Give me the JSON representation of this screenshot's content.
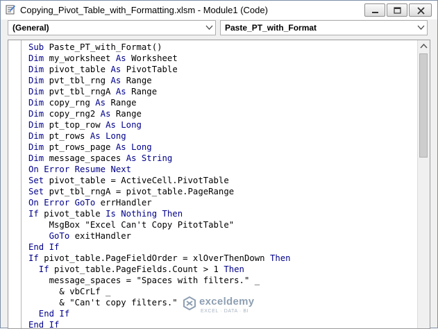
{
  "window": {
    "title": "Copying_Pivot_Table_with_Formatting.xlsm - Module1 (Code)",
    "icons": {
      "app": "vba-module-icon",
      "minimize": "minimize-icon",
      "maximize": "maximize-icon",
      "close": "close-icon"
    }
  },
  "object_combo": {
    "value": "(General)"
  },
  "procedure_combo": {
    "value": "Paste_PT_with_Format"
  },
  "colors": {
    "keyword": "#00008b",
    "plain": "#000000",
    "watermark": "#7b8fa6"
  },
  "code_lines": [
    [
      {
        "t": "Sub ",
        "k": "kw"
      },
      {
        "t": "Paste_PT_with_Format()",
        "k": "pl"
      }
    ],
    [
      {
        "t": "Dim ",
        "k": "kw"
      },
      {
        "t": "my_worksheet ",
        "k": "pl"
      },
      {
        "t": "As ",
        "k": "kw"
      },
      {
        "t": "Worksheet",
        "k": "pl"
      }
    ],
    [
      {
        "t": "Dim ",
        "k": "kw"
      },
      {
        "t": "pivot_table ",
        "k": "pl"
      },
      {
        "t": "As ",
        "k": "kw"
      },
      {
        "t": "PivotTable",
        "k": "pl"
      }
    ],
    [
      {
        "t": "Dim ",
        "k": "kw"
      },
      {
        "t": "pvt_tbl_rng ",
        "k": "pl"
      },
      {
        "t": "As ",
        "k": "kw"
      },
      {
        "t": "Range",
        "k": "pl"
      }
    ],
    [
      {
        "t": "Dim ",
        "k": "kw"
      },
      {
        "t": "pvt_tbl_rngA ",
        "k": "pl"
      },
      {
        "t": "As ",
        "k": "kw"
      },
      {
        "t": "Range",
        "k": "pl"
      }
    ],
    [
      {
        "t": "Dim ",
        "k": "kw"
      },
      {
        "t": "copy_rng ",
        "k": "pl"
      },
      {
        "t": "As ",
        "k": "kw"
      },
      {
        "t": "Range",
        "k": "pl"
      }
    ],
    [
      {
        "t": "Dim ",
        "k": "kw"
      },
      {
        "t": "copy_rng2 ",
        "k": "pl"
      },
      {
        "t": "As ",
        "k": "kw"
      },
      {
        "t": "Range",
        "k": "pl"
      }
    ],
    [
      {
        "t": "Dim ",
        "k": "kw"
      },
      {
        "t": "pt_top_row ",
        "k": "pl"
      },
      {
        "t": "As Long",
        "k": "kw"
      }
    ],
    [
      {
        "t": "Dim ",
        "k": "kw"
      },
      {
        "t": "pt_rows ",
        "k": "pl"
      },
      {
        "t": "As Long",
        "k": "kw"
      }
    ],
    [
      {
        "t": "Dim ",
        "k": "kw"
      },
      {
        "t": "pt_rows_page ",
        "k": "pl"
      },
      {
        "t": "As Long",
        "k": "kw"
      }
    ],
    [
      {
        "t": "Dim ",
        "k": "kw"
      },
      {
        "t": "message_spaces ",
        "k": "pl"
      },
      {
        "t": "As String",
        "k": "kw"
      }
    ],
    [
      {
        "t": "On Error Resume Next",
        "k": "kw"
      }
    ],
    [
      {
        "t": "Set ",
        "k": "kw"
      },
      {
        "t": "pivot_table = ActiveCell.PivotTable",
        "k": "pl"
      }
    ],
    [
      {
        "t": "Set ",
        "k": "kw"
      },
      {
        "t": "pvt_tbl_rngA = pivot_table.PageRange",
        "k": "pl"
      }
    ],
    [
      {
        "t": "On Error GoTo ",
        "k": "kw"
      },
      {
        "t": "errHandler",
        "k": "pl"
      }
    ],
    [
      {
        "t": "If ",
        "k": "kw"
      },
      {
        "t": "pivot_table ",
        "k": "pl"
      },
      {
        "t": "Is Nothing Then",
        "k": "kw"
      }
    ],
    [
      {
        "t": "    MsgBox \"Excel Can't Copy PitotTable\"",
        "k": "pl"
      }
    ],
    [
      {
        "t": "    GoTo ",
        "k": "kw"
      },
      {
        "t": "exitHandler",
        "k": "pl"
      }
    ],
    [
      {
        "t": "End If",
        "k": "kw"
      }
    ],
    [
      {
        "t": "If ",
        "k": "kw"
      },
      {
        "t": "pivot_table.PageFieldOrder = xlOverThenDown ",
        "k": "pl"
      },
      {
        "t": "Then",
        "k": "kw"
      }
    ],
    [
      {
        "t": "  If ",
        "k": "kw"
      },
      {
        "t": "pivot_table.PageFields.Count > 1 ",
        "k": "pl"
      },
      {
        "t": "Then",
        "k": "kw"
      }
    ],
    [
      {
        "t": "    message_spaces = \"Spaces with filters.\" _",
        "k": "pl"
      }
    ],
    [
      {
        "t": "      & vbCrLf _",
        "k": "pl"
      }
    ],
    [
      {
        "t": "      & \"Can't copy filters.\"",
        "k": "pl"
      }
    ],
    [
      {
        "t": "  End If",
        "k": "kw"
      }
    ],
    [
      {
        "t": "End If",
        "k": "kw"
      }
    ]
  ],
  "watermark": {
    "name": "exceldemy",
    "tagline": "EXCEL · DATA · BI"
  }
}
